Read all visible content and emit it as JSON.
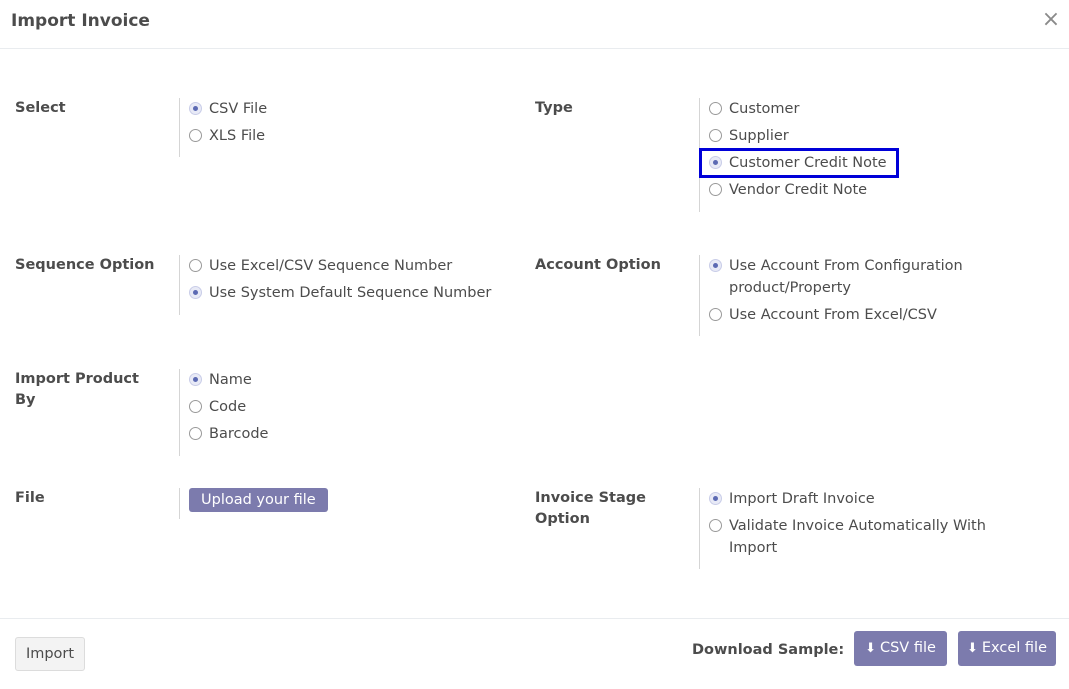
{
  "dialog": {
    "title": "Import Invoice",
    "close_icon": "close-icon"
  },
  "select": {
    "label": "Select",
    "options": [
      {
        "label": "CSV File",
        "checked": true
      },
      {
        "label": "XLS File",
        "checked": false
      }
    ]
  },
  "type": {
    "label": "Type",
    "options": [
      {
        "label": "Customer",
        "checked": false
      },
      {
        "label": "Supplier",
        "checked": false
      },
      {
        "label": "Customer Credit Note",
        "checked": true
      },
      {
        "label": "Vendor Credit Note",
        "checked": false
      }
    ]
  },
  "sequence": {
    "label": "Sequence Option",
    "options": [
      {
        "label": "Use Excel/CSV Sequence Number",
        "checked": false
      },
      {
        "label": "Use System Default Sequence Number",
        "checked": true
      }
    ]
  },
  "account": {
    "label": "Account Option",
    "options": [
      {
        "label": "Use Account From Configuration product/Property",
        "checked": true
      },
      {
        "label": "Use Account From Excel/CSV",
        "checked": false
      }
    ]
  },
  "product": {
    "label": "Import Product By",
    "options": [
      {
        "label": "Name",
        "checked": true
      },
      {
        "label": "Code",
        "checked": false
      },
      {
        "label": "Barcode",
        "checked": false
      }
    ]
  },
  "file": {
    "label": "File",
    "upload_label": "Upload your file"
  },
  "stage": {
    "label": "Invoice Stage Option",
    "options": [
      {
        "label": "Import Draft Invoice",
        "checked": true
      },
      {
        "label": "Validate Invoice Automatically With Import",
        "checked": false
      }
    ]
  },
  "footer": {
    "import_label": "Import",
    "download_label": "Download Sample:",
    "csv_label": "CSV file",
    "excel_label": "Excel file",
    "download_icon": "download-icon"
  },
  "colors": {
    "accent": "#7c7bad",
    "highlight": "#0000d8",
    "radio_dot": "#5c6ab3"
  }
}
